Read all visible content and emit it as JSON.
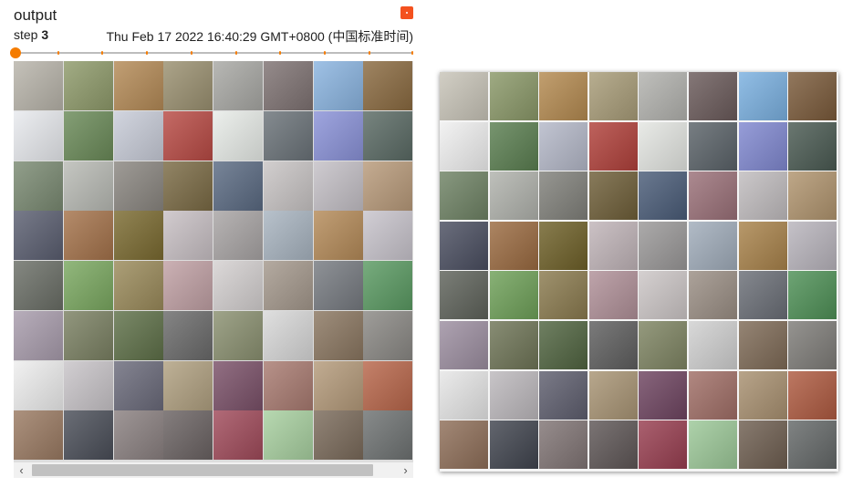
{
  "card": {
    "title": "output",
    "step_label": "step",
    "step_value": "3",
    "timestamp": "Thu Feb 17 2022 16:40:29 GMT+0800 (中国标准时间)"
  },
  "slider": {
    "position_fraction": 0
  },
  "scrollbar": {
    "left_arrow": "‹",
    "right_arrow": "›"
  },
  "palette": {
    "accent": "#f57c00",
    "status_icon": "#f4511e"
  },
  "output_grid": {
    "rows": 8,
    "cols": 8,
    "tiles": [
      "#b8b4aa",
      "#8e9a6a",
      "#b48a56",
      "#9a9070",
      "#a8a8a4",
      "#7e7272",
      "#8ab4e0",
      "#8a6a40",
      "#e8eaee",
      "#6a8a58",
      "#c8ccd8",
      "#b84a44",
      "#e8ece8",
      "#6a7278",
      "#8a92d8",
      "#5a6a64",
      "#7a8a72",
      "#b8bab4",
      "#8a8680",
      "#7a6a44",
      "#5a6a82",
      "#c8c4c4",
      "#c4c0c6",
      "#b89a7a",
      "#5a5e70",
      "#a4724a",
      "#7a6a30",
      "#c8c0c4",
      "#a8a4a4",
      "#a8b4c0",
      "#b48a58",
      "#c8c4cc",
      "#6a6e66",
      "#7aa860",
      "#9a8a5a",
      "#c0a0a4",
      "#d4d0d0",
      "#a4988c",
      "#767a80",
      "#5a9a62",
      "#a89cac",
      "#7a8062",
      "#5e7048",
      "#6a6a6a",
      "#8a9070",
      "#d8d8d8",
      "#8a7660",
      "#8a8884",
      "#eeeeee",
      "#c8c4c8",
      "#6a6a7a",
      "#b0a080",
      "#7a5068",
      "#a87a70",
      "#b49a7a",
      "#b8664a",
      "#9a7a62",
      "#4a4e58",
      "#8a8080",
      "#6a6262",
      "#a04a5a",
      "#a8d0a0",
      "#7a6a5a",
      "#6e7272"
    ]
  },
  "preview_grid": {
    "rows": 8,
    "cols": 8,
    "tiles": [
      "#c8c4b8",
      "#8a9868",
      "#b48a50",
      "#a89c78",
      "#b2b2ae",
      "#6a5a5a",
      "#7ab0e0",
      "#7a5a3a",
      "#f0f0f0",
      "#5a7e50",
      "#b4b8c8",
      "#b0403a",
      "#e4e6e2",
      "#5a6268",
      "#8088d0",
      "#4a5a52",
      "#6e8264",
      "#b0b2ac",
      "#80807a",
      "#6e5e38",
      "#4a5c78",
      "#9a7078",
      "#c0bcbe",
      "#b0946e",
      "#4a4e60",
      "#9a6a40",
      "#6e6028",
      "#c0b4b8",
      "#9a9898",
      "#a0acba",
      "#a8824a",
      "#b8b4bc",
      "#5e625a",
      "#6ea058",
      "#8a7a4e",
      "#b09098",
      "#ccc6c6",
      "#9a8e84",
      "#6a6e76",
      "#4e9056",
      "#9c8ea0",
      "#6e7456",
      "#506440",
      "#5e5e5e",
      "#7e8462",
      "#d0d0d0",
      "#7e6a56",
      "#7e7c78",
      "#e6e6e6",
      "#bcb8bc",
      "#5e5e6e",
      "#a89474",
      "#6e4460",
      "#a06e66",
      "#a89070",
      "#ae5a40",
      "#8e6e58",
      "#40444e",
      "#807474",
      "#5e5656",
      "#983e50",
      "#9cc898",
      "#6e5e50",
      "#646868"
    ]
  }
}
